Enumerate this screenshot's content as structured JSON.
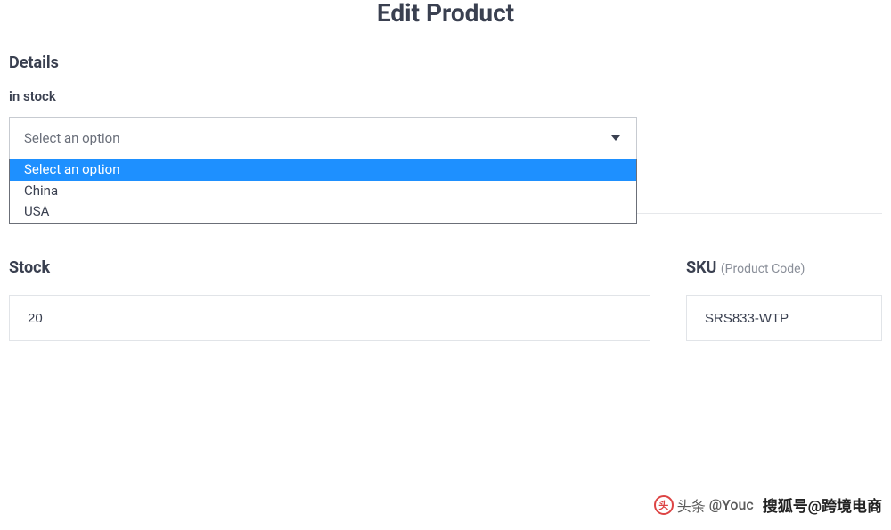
{
  "page_title": "Edit Product",
  "details": {
    "heading": "Details",
    "in_stock": {
      "label": "in stock",
      "selected": "Select an option",
      "options": [
        {
          "label": "Select an option",
          "selected": true
        },
        {
          "label": "China",
          "selected": false
        },
        {
          "label": "USA",
          "selected": false
        }
      ]
    }
  },
  "stock": {
    "heading": "Stock",
    "value": "20"
  },
  "sku": {
    "heading": "SKU",
    "sub": "(Product Code)",
    "value": "SRS833-WTP"
  },
  "watermarks": {
    "left_prefix": "头条",
    "left_name": "@Youc",
    "right": "搜狐号@跨境电商"
  }
}
